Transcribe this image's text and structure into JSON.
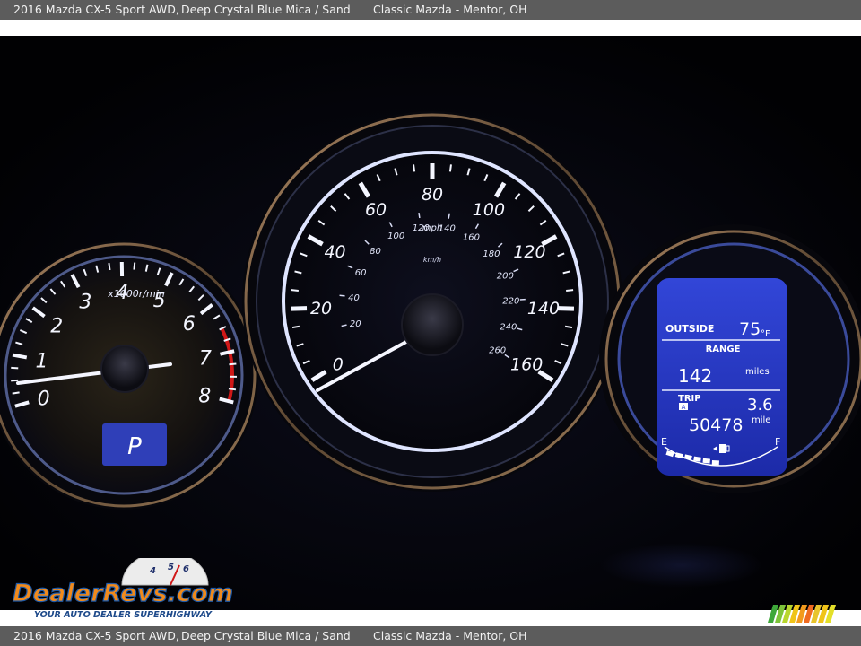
{
  "caption": {
    "vehicle": "2016 Mazda CX-5 Sport AWD,",
    "color": "Deep Crystal Blue Mica / Sand",
    "dealer": "Classic Mazda - Mentor, OH"
  },
  "tachometer": {
    "numbers": [
      "0",
      "1",
      "2",
      "3",
      "4",
      "5",
      "6",
      "7",
      "8"
    ],
    "unit": "x1000r/min",
    "gear": "P"
  },
  "speedometer": {
    "mph_numbers": [
      "0",
      "20",
      "40",
      "60",
      "80",
      "100",
      "120",
      "140",
      "160"
    ],
    "mph_unit": "mph",
    "kmh_numbers": [
      "20",
      "40",
      "60",
      "80",
      "100",
      "120",
      "140",
      "160",
      "180",
      "200",
      "220",
      "240",
      "260"
    ],
    "kmh_unit": "km/h"
  },
  "info_display": {
    "outside_label": "OUTSIDE",
    "outside_temp": "75",
    "temp_unit": "°F",
    "range_label": "RANGE",
    "range_value": "142",
    "range_unit": "miles",
    "trip_label": "TRIP",
    "trip_sub": "A",
    "trip_value": "3.6",
    "odometer": "50478",
    "odometer_unit": "mile",
    "fuel_empty": "E",
    "fuel_full": "F"
  },
  "watermark": {
    "brand": "DealerRevs.com",
    "tagline": "YOUR AUTO DEALER SUPERHIGHWAY",
    "gauge_digits": [
      "4",
      "5",
      "6"
    ]
  },
  "colors": {
    "gauge_white": "#f4f6ff",
    "ring_bronze": "#8a6a48",
    "display_blue": "#2a3fcf",
    "redline": "#d01818",
    "logo_orange": "#f08a1c",
    "logo_blue": "#1e5aa8"
  }
}
